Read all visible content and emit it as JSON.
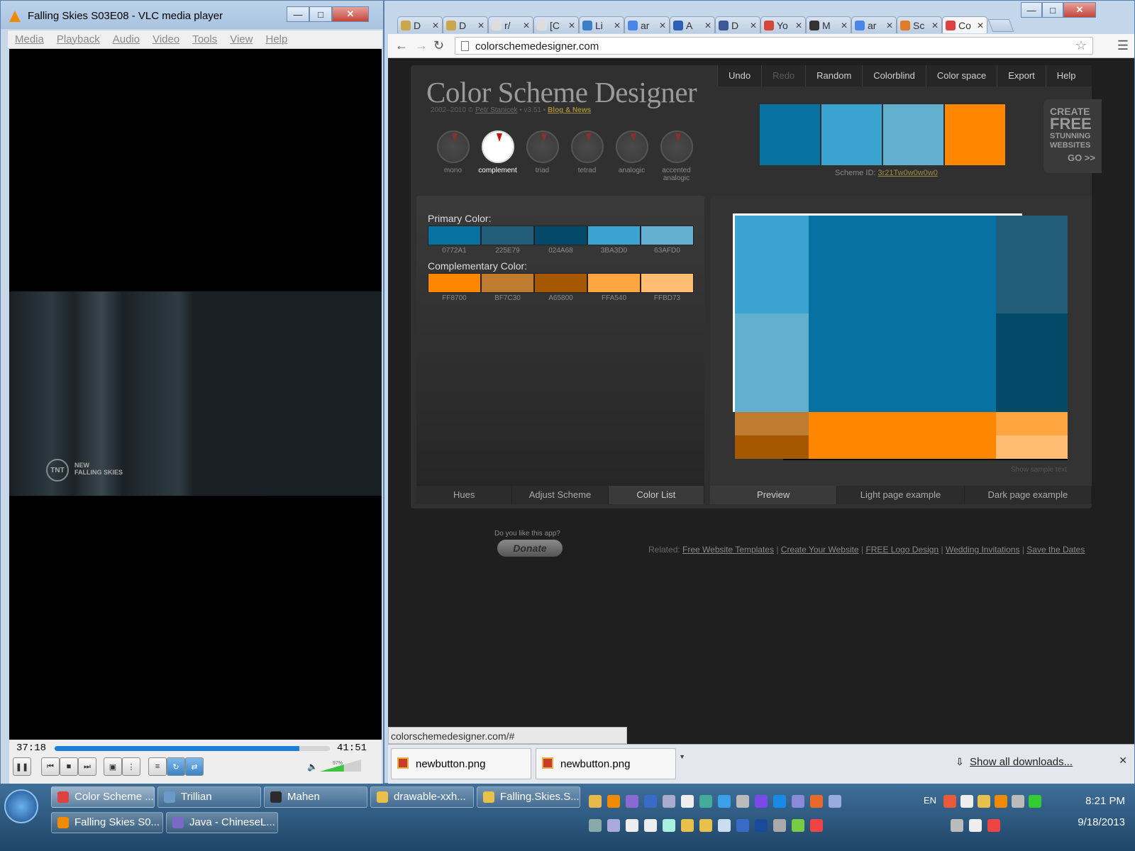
{
  "vlc": {
    "title": "Falling Skies S03E08 - VLC media player",
    "menu": [
      "Media",
      "Playback",
      "Audio",
      "Video",
      "Tools",
      "View",
      "Help"
    ],
    "elapsed": "37:18",
    "total": "41:51",
    "progress": 0.89,
    "volume": "97%",
    "overlay_logo": "TNT",
    "overlay_text_1": "NEW",
    "overlay_text_2": "FALLING SKIES"
  },
  "chrome": {
    "tabs": [
      {
        "label": "D",
        "color": "#c8a84a"
      },
      {
        "label": "D",
        "color": "#c8a84a"
      },
      {
        "label": "r/",
        "color": "#dddddd"
      },
      {
        "label": "[C",
        "color": "#dddddd"
      },
      {
        "label": "Li",
        "color": "#3a7fc8"
      },
      {
        "label": "ar",
        "color": "#4a86e8"
      },
      {
        "label": "A",
        "color": "#2a60b8"
      },
      {
        "label": "D",
        "color": "#3b5998"
      },
      {
        "label": "Yo",
        "color": "#d44638"
      },
      {
        "label": "M",
        "color": "#333333"
      },
      {
        "label": "ar",
        "color": "#4a86e8"
      },
      {
        "label": "Sc",
        "color": "#e07b2a"
      },
      {
        "label": "Co",
        "color": "#e04040",
        "active": true
      }
    ],
    "url": "colorschemedesigner.com",
    "status_url": "colorschemedesigner.com/#"
  },
  "csd": {
    "menu": [
      "Undo",
      "Redo",
      "Random",
      "Colorblind",
      "Color space",
      "Export",
      "Help"
    ],
    "menu_disabled": [
      "Redo"
    ],
    "logo": "Color Scheme Designer",
    "credit_prefix": "2002–2010 ©",
    "credit_author": "Petr Stanicek",
    "credit_version": "• v3.51 •",
    "credit_blog": "Blog & News",
    "dials": [
      "mono",
      "complement",
      "triad",
      "tetrad",
      "analogic",
      "accented analogic"
    ],
    "active_dial": "complement",
    "top_swatches": [
      "#0772A1",
      "#3BA3D0",
      "#63AFD0",
      "#FF8700"
    ],
    "scheme_id_label": "Scheme ID:",
    "scheme_id": "3r21Tw0w0w0w0",
    "ad": [
      "CREATE",
      "FREE",
      "STUNNING",
      "WEBSITES",
      "GO >>"
    ],
    "primary_label": "Primary Color:",
    "primary": [
      "0772A1",
      "225E79",
      "024A68",
      "3BA3D0",
      "63AFD0"
    ],
    "complement_label": "Complementary Color:",
    "complement": [
      "FF8700",
      "BF7C30",
      "A65800",
      "FFA540",
      "FFBD73"
    ],
    "left_tabs": [
      "Hues",
      "Adjust Scheme",
      "Color List"
    ],
    "left_tab_selected": "Color List",
    "right_tabs": [
      "Preview",
      "Light page example",
      "Dark page example"
    ],
    "right_tab_selected": "Preview",
    "show_sample": "Show sample text",
    "donate_question": "Do you like this app?",
    "donate": "Donate",
    "related_label": "Related:",
    "related": [
      "Free Website Templates",
      "Create Your Website",
      "FREE Logo Design",
      "Wedding Invitations",
      "Save the Dates"
    ]
  },
  "downloads": {
    "items": [
      "newbutton.png",
      "newbutton.png"
    ],
    "show_all": "Show all downloads..."
  },
  "taskbar": {
    "row1": [
      {
        "label": "Color Scheme ...",
        "color": "#e04040",
        "active": true
      },
      {
        "label": "Trillian",
        "color": "#6a9ac8"
      },
      {
        "label": "Mahen",
        "color": "#2b2b2b"
      },
      {
        "label": "drawable-xxh...",
        "color": "#e8c04a"
      },
      {
        "label": "Falling.Skies.S...",
        "color": "#e8c04a"
      }
    ],
    "row2": [
      {
        "label": "Falling Skies S0...",
        "color": "#f08a00"
      },
      {
        "label": "Java - ChineseL...",
        "color": "#7a6ac8"
      }
    ],
    "language": "EN",
    "time": "8:21 PM",
    "date": "9/18/2013"
  }
}
